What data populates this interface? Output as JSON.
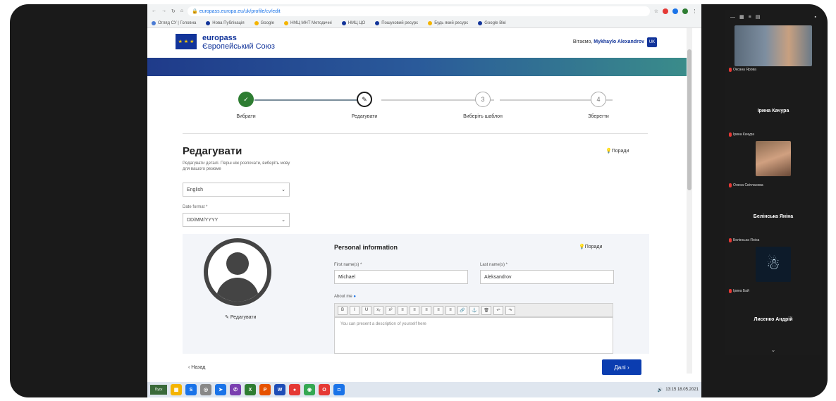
{
  "browser": {
    "address": "europass.europa.eu/uk/profile/cv/edit",
    "bookmarks": [
      "Огляд СУ | Головна",
      "Нова Публікація",
      "Google",
      "НМЦ МНТ Методичні",
      "НМЦ ЦО",
      "Пошуковий ресурс",
      "Будь який ресурс",
      "Google Вікі"
    ]
  },
  "europass": {
    "brand_line1": "europass",
    "brand_line2": "Європейський Союз",
    "user_prefix": "Вітаємо,",
    "user_name": "Mykhaylo Alexandrov",
    "lang_code": "UK"
  },
  "steps": [
    {
      "number": "✓",
      "label": "Вибрати",
      "state": "done"
    },
    {
      "number": "✎",
      "label": "Редагувати",
      "state": "active"
    },
    {
      "number": "3",
      "label": "Виберіть шаблон",
      "state": "todo"
    },
    {
      "number": "4",
      "label": "Зберегти",
      "state": "todo"
    }
  ],
  "edit": {
    "title": "Редагувати",
    "help": "Поради",
    "lang_label": "Редагувати деталі. Перш ніж розпочати, виберіть мову для вашого резюме",
    "lang_value": "English",
    "date_label": "Date format *",
    "date_value": "DD/MM/YYYY"
  },
  "personal": {
    "title": "Personal information",
    "help": "Поради",
    "edit_photo": "Редагувати",
    "first_name_label": "First name(s) *",
    "first_name_value": "Michael",
    "last_name_label": "Last name(s) *",
    "last_name_value": "Aleksandrov",
    "about_label": "About me",
    "about_placeholder": "You can present a description of yourself here",
    "toolbar": [
      "B",
      "I",
      "U",
      "x₂",
      "x²",
      "≡",
      "≡",
      "≡",
      "≡",
      "≡",
      "🔗",
      "⚓",
      "🗑",
      "↶",
      "↷"
    ]
  },
  "footer": {
    "back": "Назад",
    "next": "Далі"
  },
  "taskbar": {
    "start": "Пуск",
    "time": "13:15",
    "date": "18.05.2021"
  },
  "participants": [
    {
      "name": "",
      "label": "Оксана Ярова",
      "video": true
    },
    {
      "name": "Ірина Качура",
      "label": "Ірина Качура",
      "video": false
    },
    {
      "name": "",
      "label": "Олена Світланова",
      "video": true
    },
    {
      "name": "Белінська Яніна",
      "label": "Белінська Яніна",
      "video": false
    },
    {
      "name": "",
      "label": "Ірина Бай",
      "video": true
    },
    {
      "name": "Лисенко Андрій",
      "label": "",
      "video": false
    }
  ],
  "colors": {
    "eu_blue": "#12349a",
    "step_done": "#2e7d32",
    "next_button": "#0b3db0"
  }
}
